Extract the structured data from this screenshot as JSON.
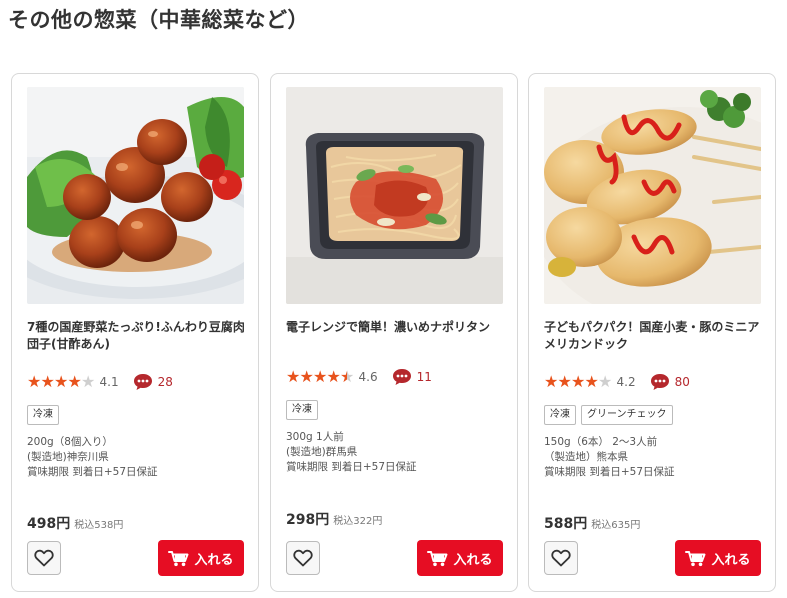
{
  "section": {
    "title": "その他の惣菜（中華総菜など）"
  },
  "products": [
    {
      "name": "7種の国産野菜たっぷり!ふんわり豆腐肉団子(甘酢あん)",
      "stars": 4,
      "half_star": false,
      "max_stars": 5,
      "rating": "4.1",
      "review_count": "28",
      "tags": [
        "冷凍"
      ],
      "spec": [
        "200g（8個入り）",
        "(製造地)神奈川県",
        "賞味期限 到着日+57日保証"
      ],
      "price": "498円",
      "price_tax": "税込538円",
      "cart_label": "入れる"
    },
    {
      "name": "電子レンジで簡単！濃いめナポリタン",
      "stars": 4,
      "half_star": true,
      "max_stars": 5,
      "rating": "4.6",
      "review_count": "11",
      "tags": [
        "冷凍"
      ],
      "spec": [
        "300g 1人前",
        "(製造地)群馬県",
        "賞味期限 到着日+57日保証"
      ],
      "price": "298円",
      "price_tax": "税込322円",
      "cart_label": "入れる"
    },
    {
      "name": "子どもパクパク！国産小麦・豚のミニアメリカンドック",
      "stars": 4,
      "half_star": false,
      "max_stars": 5,
      "rating": "4.2",
      "review_count": "80",
      "tags": [
        "冷凍",
        "グリーンチェック"
      ],
      "spec": [
        "150g（6本） 2～3人前",
        "（製造地）熊本県",
        "賞味期限 到着日+57日保証"
      ],
      "price": "588円",
      "price_tax": "税込635円",
      "cart_label": "入れる"
    }
  ],
  "icons": {
    "star": "star-icon",
    "review": "comment-bubble-icon",
    "favorite": "heart-icon",
    "cart": "cart-icon"
  },
  "colors": {
    "accent_red": "#e60d23",
    "star": "#e8531d",
    "review": "#b5282d"
  }
}
